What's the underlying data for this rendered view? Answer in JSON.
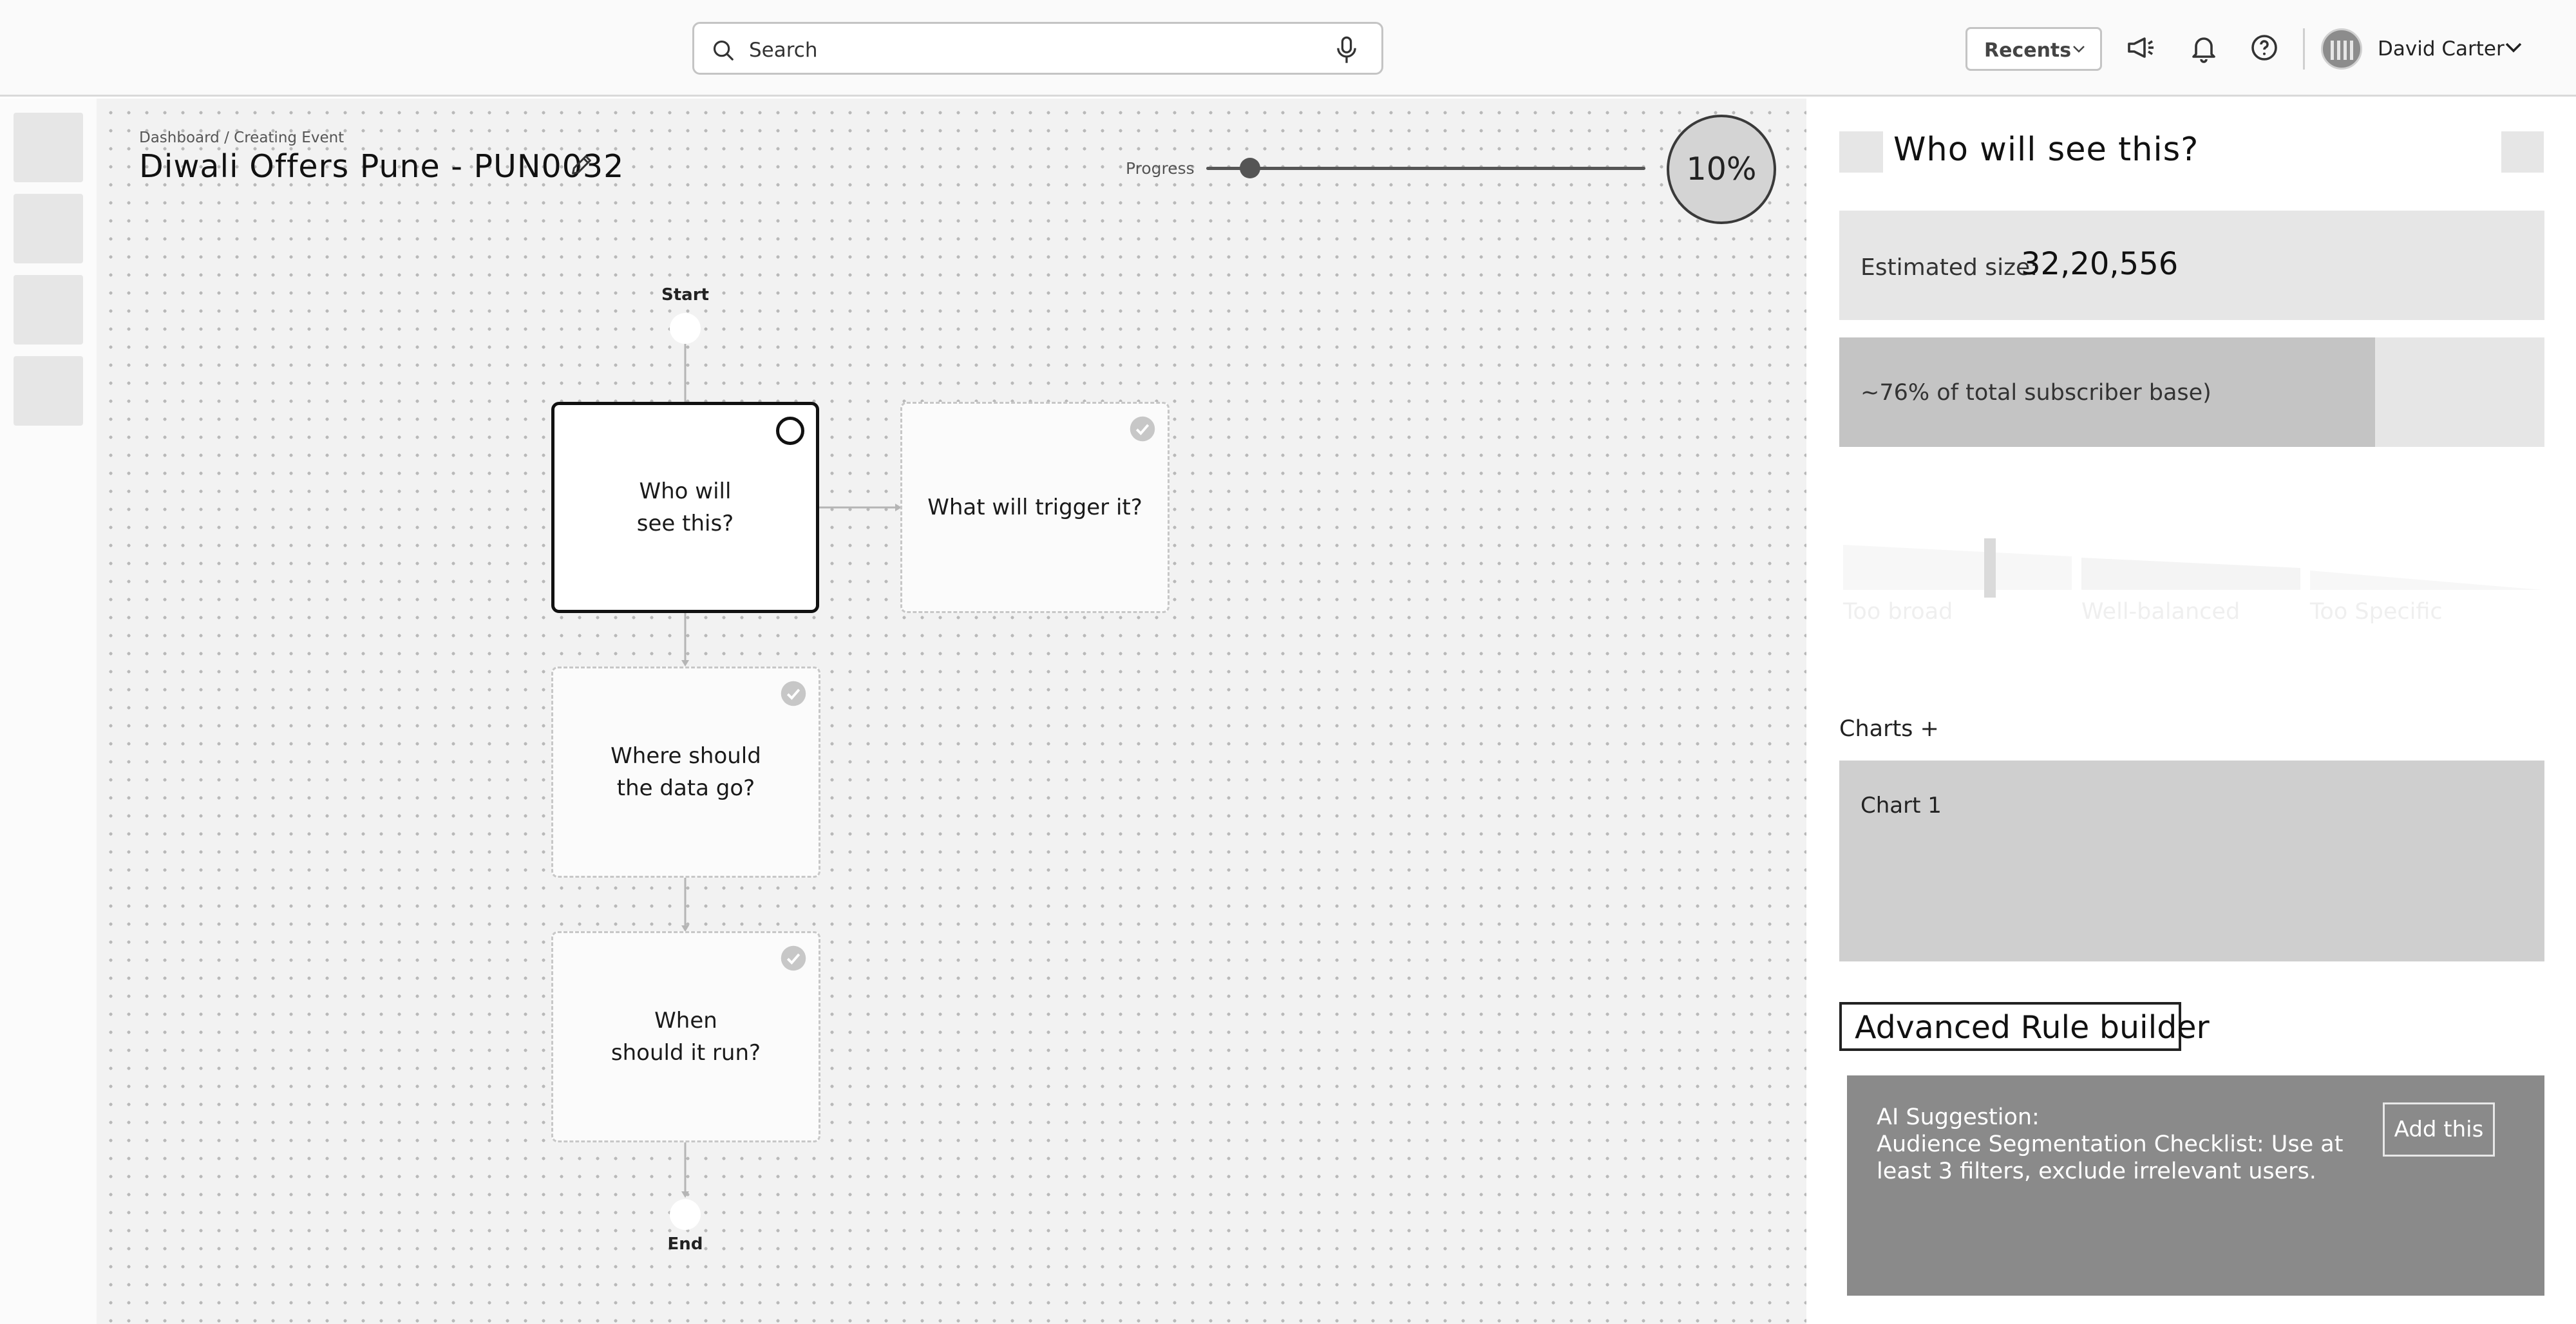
{
  "header": {
    "search_placeholder": "Search",
    "recents_label": "Recents",
    "user_name": "David Carter"
  },
  "canvas": {
    "breadcrumb": "Dashboard / Creating Event",
    "title": "Diwali Offers Pune - PUN0032",
    "progress_label": "Progress",
    "progress_percent": 10,
    "progress_text": "10%",
    "flow": {
      "start_label": "Start",
      "end_label": "End",
      "nodes": [
        {
          "text": "Who will\nsee this?",
          "state": "active"
        },
        {
          "text": "What will trigger it?",
          "state": "complete"
        },
        {
          "text": "Where should\nthe data go?",
          "state": "complete"
        },
        {
          "text": "When\nshould it run?",
          "state": "complete"
        }
      ]
    }
  },
  "panel": {
    "title": "Who will see this?",
    "estimated_label": "Estimated size:",
    "estimated_value": "32,20,556",
    "subscriber_text": "~76% of total subscriber base)",
    "subscriber_fraction": 0.76,
    "audience_scale": {
      "labels": [
        "Too broad",
        "Well-balanced",
        "Too Specific"
      ],
      "marker_position": 0.21
    },
    "charts_heading": "Charts +",
    "chart_1_label": "Chart 1",
    "advanced_rule_builder": "Advanced Rule builder",
    "ai_suggestion_title": "AI Suggestion:",
    "ai_suggestion_text": "Audience Segmentation Checklist: Use at least 3 filters, exclude irrelevant users.",
    "add_this_label": "Add this"
  },
  "colors": {
    "canvas_bg": "#f2f2f2",
    "panel_block": "#e6e6e6",
    "ai_block": "#8a8a8a",
    "active_border": "#111111"
  },
  "icons": [
    "search-icon",
    "microphone-icon",
    "chevron-down-icon",
    "megaphone-icon",
    "bell-icon",
    "help-icon",
    "pencil-icon",
    "check-icon"
  ]
}
